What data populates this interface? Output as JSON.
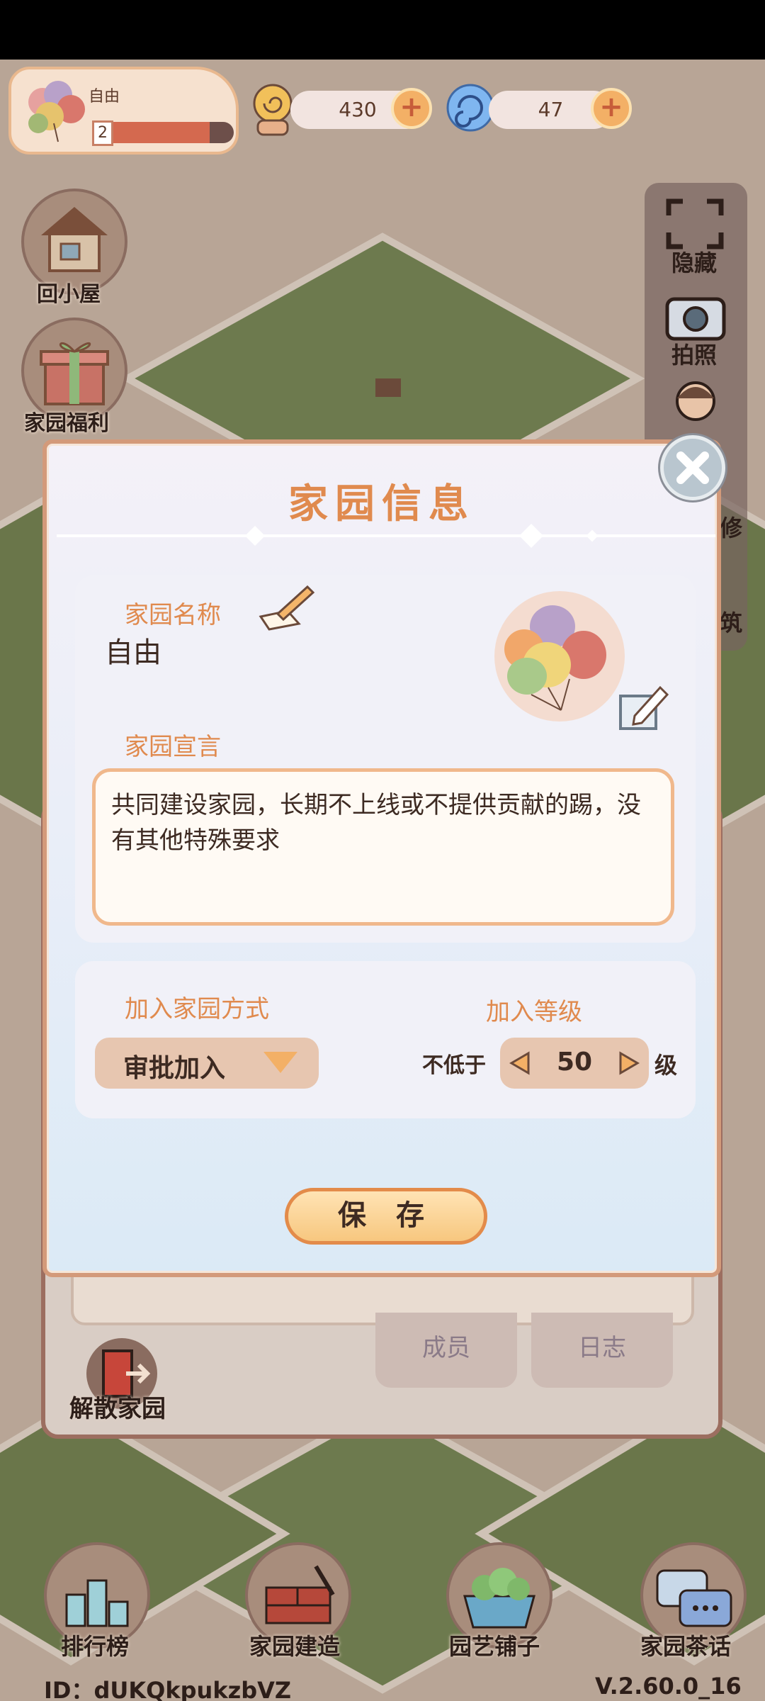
{
  "hud": {
    "home_name": "自由",
    "level": "2",
    "level_progress": 0.8
  },
  "resources": [
    {
      "value": "430"
    },
    {
      "value": "47"
    }
  ],
  "side_buttons": {
    "back_home": "回小屋",
    "welfare": "家园福利"
  },
  "right_panel": {
    "hide": "隐藏",
    "photo": "拍照",
    "fix_fragment": "修",
    "build_fragment": "筑"
  },
  "dialog": {
    "title": "家园信息",
    "name_label": "家园名称",
    "name_value": "自由",
    "motto_label": "家园宣言",
    "motto_text": "共同建设家园，长期不上线或不提供贡献的踢，没有其他特殊要求",
    "join_method_label": "加入家园方式",
    "join_method_value": "审批加入",
    "join_level_label": "加入等级",
    "join_level_prefix": "不低于",
    "join_level_value": "50",
    "join_level_suffix": "级",
    "save_label": "保 存"
  },
  "back_panel": {
    "tab_members": "成员",
    "tab_logs": "日志",
    "dissolve": "解散家园"
  },
  "bottom_nav": [
    {
      "label": "排行榜"
    },
    {
      "label": "家园建造"
    },
    {
      "label": "园艺铺子"
    },
    {
      "label": "家园茶话"
    }
  ],
  "footer": {
    "id": "ID：dUKQkpukzbVZ",
    "version": "V.2.60.0_16"
  },
  "colors": {
    "accent_orange": "#e08a4e",
    "dialog_border": "#d39a7a",
    "button_fill": "#f7c77f",
    "text_dark": "#3d2a22"
  }
}
